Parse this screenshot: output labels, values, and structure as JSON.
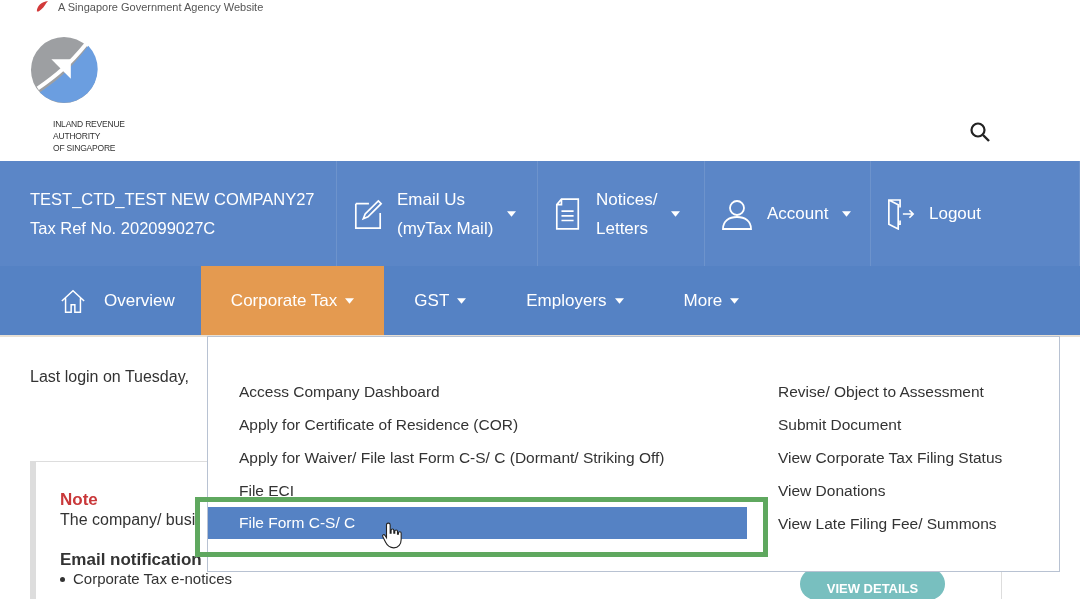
{
  "gov_banner": {
    "text": "A Singapore Government Agency Website"
  },
  "logo": {
    "lines": [
      "INLAND REVENUE",
      "AUTHORITY",
      "OF SINGAPORE"
    ]
  },
  "account_bar": {
    "company": "TEST_CTD_TEST NEW COMPANY27",
    "tax_ref": "Tax Ref No. 202099027C",
    "items": [
      {
        "kind": "mail",
        "lines": [
          "Email Us",
          "(myTax Mail)"
        ],
        "dropdown": true
      },
      {
        "kind": "notices",
        "lines": [
          "Notices/",
          "Letters"
        ],
        "dropdown": true
      },
      {
        "kind": "account",
        "lines": [
          "Account"
        ],
        "dropdown": true
      },
      {
        "kind": "logout",
        "lines": [
          "Logout"
        ],
        "dropdown": false
      }
    ]
  },
  "nav": {
    "tabs": [
      {
        "label": "Overview",
        "kind": "home",
        "dropdown": false,
        "selected": false
      },
      {
        "label": "Corporate Tax",
        "kind": "menu",
        "dropdown": true,
        "selected": true
      },
      {
        "label": "GST",
        "kind": "menu",
        "dropdown": true,
        "selected": false
      },
      {
        "label": "Employers",
        "kind": "menu",
        "dropdown": true,
        "selected": false
      },
      {
        "label": "More",
        "kind": "menu",
        "dropdown": true,
        "selected": false
      }
    ]
  },
  "dropdown_menu": {
    "columns": [
      [
        {
          "label": "Access Company Dashboard",
          "selected": false
        },
        {
          "label": "Apply for Certificate of Residence (COR)",
          "selected": false
        },
        {
          "label": "Apply for Waiver/ File last Form C-S/ C (Dormant/ Striking Off)",
          "selected": false
        },
        {
          "label": "File ECI",
          "selected": false
        },
        {
          "label": "File Form C-S/ C",
          "selected": true
        }
      ],
      [
        {
          "label": "Revise/ Object to Assessment",
          "selected": false
        },
        {
          "label": "Submit Document",
          "selected": false
        },
        {
          "label": "View Corporate Tax Filing Status",
          "selected": false
        },
        {
          "label": "View Donations",
          "selected": false
        },
        {
          "label": "View Late Filing Fee/ Summons",
          "selected": false
        }
      ]
    ]
  },
  "content": {
    "last_login": "Last login on Tuesday,",
    "note": {
      "title": "Note",
      "text": "The company/ busi",
      "subheading": "Email notification",
      "bullets": [
        "Corporate Tax e-notices"
      ],
      "button": "VIEW DETAILS"
    }
  }
}
